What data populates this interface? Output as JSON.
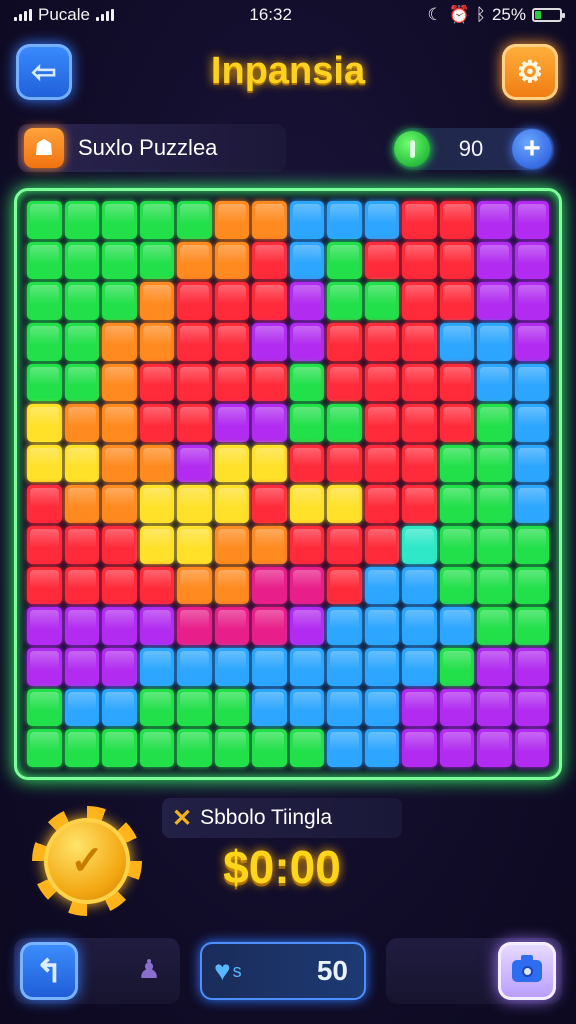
{
  "status_bar": {
    "carrier": "Pucale",
    "time": "16:32",
    "battery": "25%",
    "battery_level": 0.25
  },
  "header": {
    "title": "Inpansia",
    "back_icon": "arrow-left-icon",
    "settings_icon": "gear-icon"
  },
  "puzzle_info": {
    "name": "Suxlo Puzzlea",
    "counter_value": "90",
    "plus_label": "+"
  },
  "board": {
    "rows": 14,
    "cols": 14,
    "palette": {
      "G": "#22e04a",
      "Y": "#ffe12a",
      "O": "#ff8a1f",
      "R": "#ff2a3a",
      "P": "#b12cf0",
      "M": "#e81f8a",
      "B": "#2ca6ff",
      "C": "#2ee8c8"
    },
    "pattern": [
      "GGGGGOOBBBRRPP",
      "GGGGOORBGRRRPP",
      "GGGORRRPGGRRPP",
      "GGOORRPPRRRBBP",
      "GGORRRRGRRRRBB",
      "YOORRPPGGRRRGB",
      "YYOOPYYRRRRGGB",
      "ROOYYYRYYRRGGB",
      "RRRYYOORRRCGGG",
      "RRRROOMMRBBGGG",
      "PPPPMMMPBBBBGG",
      "PPPBBBBBBBBGPP",
      "GBBGGGBBBBPPPP",
      "GGGGGGGGBBPPPP"
    ]
  },
  "reward": {
    "icon": "x-icon",
    "label": "Sbbolo Tiingla",
    "value": "$0:00"
  },
  "bottom_bar": {
    "undo_icon": "undo-icon",
    "lives_value": "50",
    "lives_suffix": "s",
    "camera_icon": "camera-icon"
  }
}
